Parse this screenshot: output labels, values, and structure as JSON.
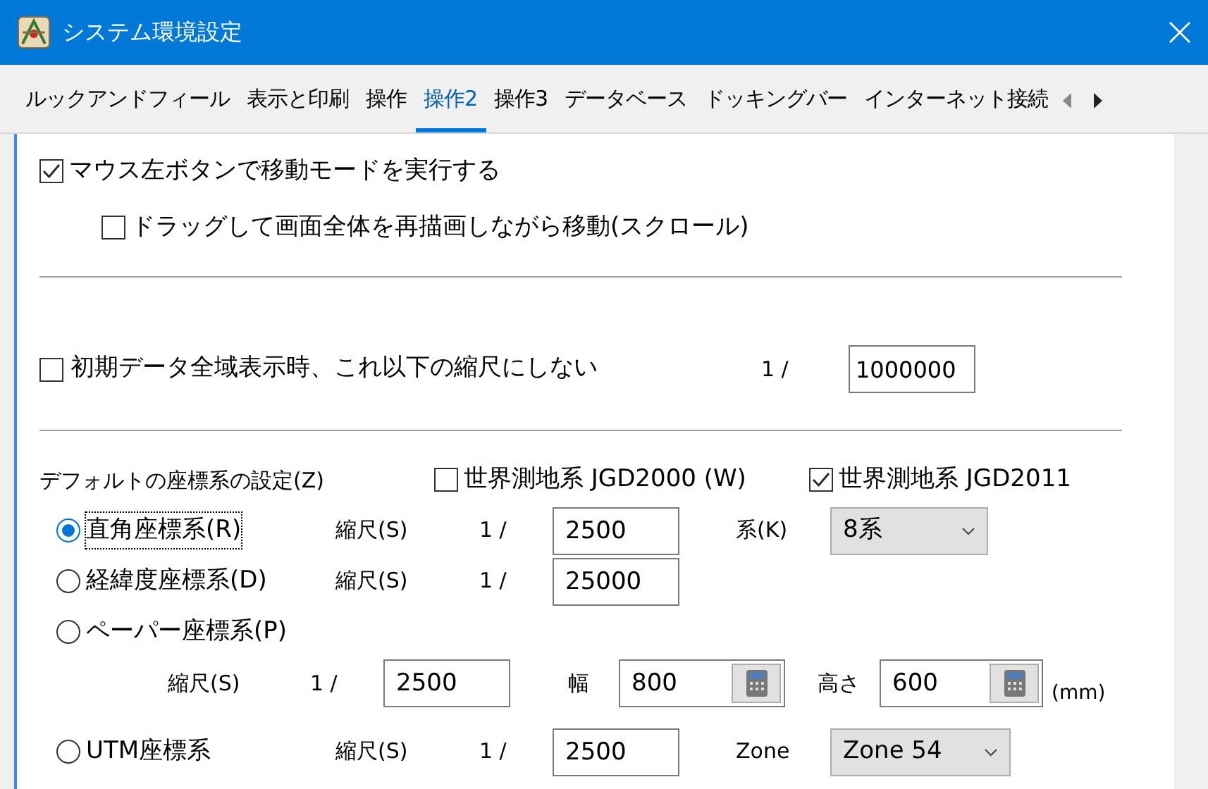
{
  "window": {
    "title": "システム環境設定"
  },
  "tabs": [
    {
      "label": "ルックアンドフィール",
      "selected": false
    },
    {
      "label": "表示と印刷",
      "selected": false
    },
    {
      "label": "操作",
      "selected": false
    },
    {
      "label": "操作2",
      "selected": true
    },
    {
      "label": "操作3",
      "selected": false
    },
    {
      "label": "データベース",
      "selected": false
    },
    {
      "label": "ドッキングバー",
      "selected": false
    },
    {
      "label": "インターネット接続",
      "selected": false
    }
  ],
  "mouse": [
    {
      "label": "マウス左ボタンで移動モードを実行する",
      "checked": true,
      "indented": false
    },
    {
      "label": "ドラッグして画面全体を再描画しながら移動(スクロール)",
      "checked": false,
      "indented": true
    }
  ],
  "min_scale": {
    "label": "初期データ全域表示時、これ以下の縮尺にしない",
    "checked": false,
    "ratio": "1 /",
    "value": "1000000"
  },
  "coordinate_system": {
    "label": "デフォルトの座標系の設定(Z)",
    "datums": [
      {
        "label": "世界測地系 JGD2000 (W)",
        "checked": false
      },
      {
        "label": "世界測地系 JGD2011",
        "checked": true
      }
    ],
    "options": [
      {
        "kind": "inline",
        "label": "直角座標系(R)",
        "selected": true,
        "focused": true,
        "scale_label": "縮尺(S)",
        "ratio": "1 /",
        "scale": "2500",
        "extra": {
          "label": "系(K)",
          "value": "8系"
        }
      },
      {
        "kind": "inline",
        "label": "経緯度座標系(D)",
        "selected": false,
        "focused": false,
        "scale_label": "縮尺(S)",
        "ratio": "1 /",
        "scale": "25000"
      },
      {
        "kind": "paper",
        "label": "ペーパー座標系(P)",
        "selected": false,
        "focused": false,
        "scale_label": "縮尺(S)",
        "ratio": "1 /",
        "scale": "2500",
        "width": {
          "label": "幅",
          "value": "800"
        },
        "height": {
          "label": "高さ",
          "value": "600"
        },
        "unit": "(mm)"
      },
      {
        "kind": "inline",
        "label": "UTM座標系",
        "selected": false,
        "focused": false,
        "scale_label": "縮尺(S)",
        "ratio": "1 /",
        "scale": "2500",
        "extra": {
          "label": "Zone",
          "value": "Zone 54"
        }
      }
    ]
  }
}
